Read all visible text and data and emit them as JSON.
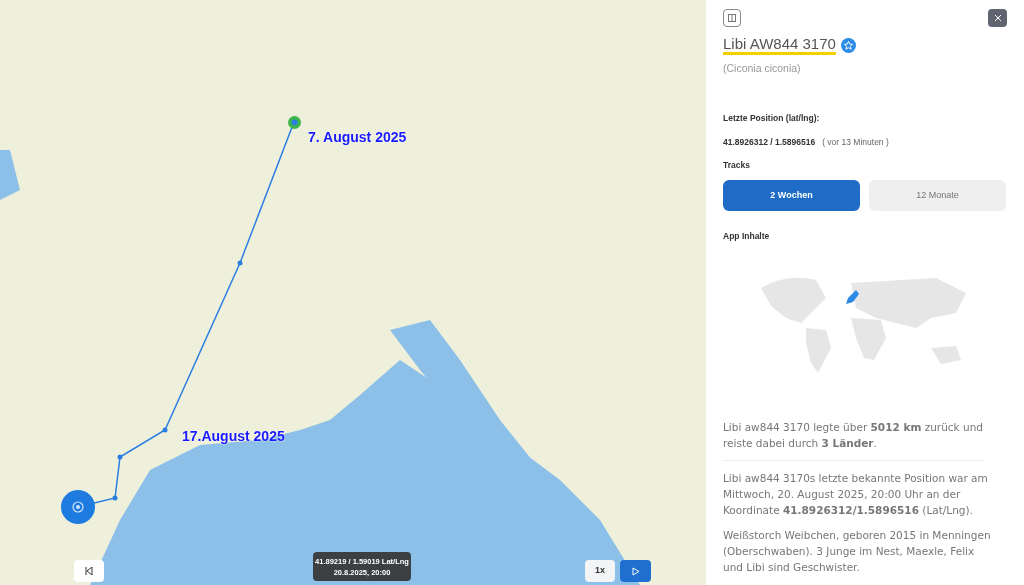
{
  "map": {
    "date_labels": [
      {
        "text": "7. August 2025"
      },
      {
        "text": "17.August 2025"
      }
    ],
    "position_tooltip": {
      "coords": "41.89219 / 1.59019 Lat/Lng",
      "time": "20.8.2025, 20:00"
    },
    "speed": "1x"
  },
  "panel": {
    "title": "Libi AW844 3170",
    "favorite": true,
    "species": "(Ciconia ciconia)",
    "last_position_label": "Letzte Position (lat/lng):",
    "last_position_value": "41.8926312 / 1.5896516",
    "last_position_age": "( vor 13 Minuten )",
    "tracks_label": "Tracks",
    "tracks": [
      {
        "label": "2 Wochen",
        "selected": true
      },
      {
        "label": "12 Monate",
        "selected": false
      }
    ],
    "app_content_label": "App Inhalte",
    "paragraphs": [
      "Libi aw844 3170 legte über **5012 km** zurück und reiste dabei durch **3 Länder**.",
      "Libi aw844 3170s letzte bekannte Position war am Mittwoch, 20. August 2025, 20:00 Uhr an der Koordinate **41.8926312/1.5896516** (Lat/Lng).",
      "Weißstorch Weibchen, geboren 2015 in Menningen (Oberschwaben). 3 Junge im Nest, Maexle, Felix und Libi sind Geschwister."
    ]
  }
}
